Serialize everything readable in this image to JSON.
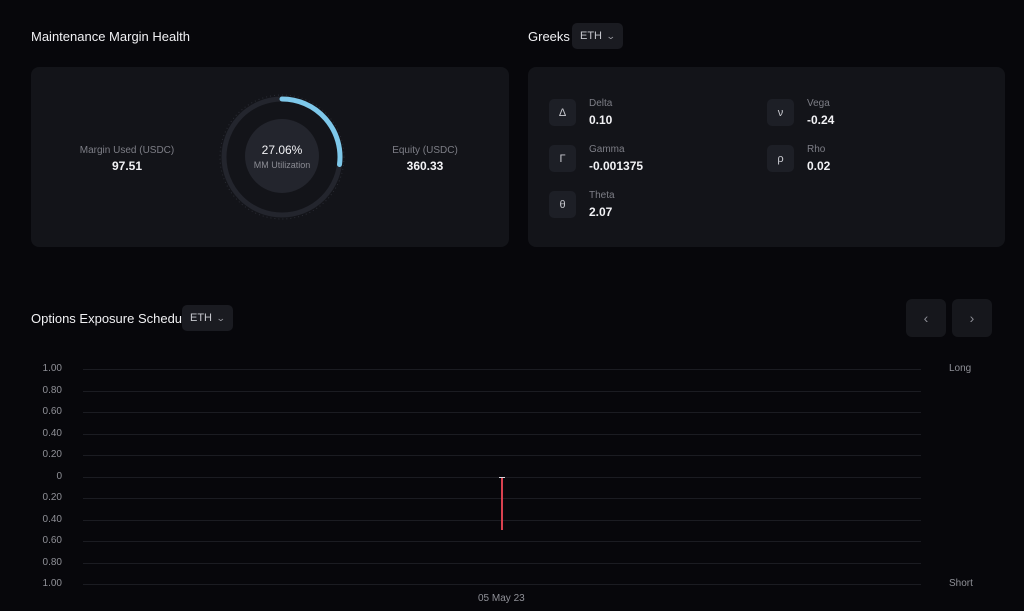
{
  "margin_health": {
    "title": "Maintenance Margin Health",
    "margin_used_label": "Margin Used (USDC)",
    "margin_used_value": "97.51",
    "equity_label": "Equity (USDC)",
    "equity_value": "360.33",
    "utilization_text": "27.06%",
    "utilization_label": "MM Utilization",
    "utilization_fraction": 0.2706,
    "arc_color": "#7ec8ea"
  },
  "greeks": {
    "title": "Greeks",
    "asset_selected": "ETH",
    "items": [
      {
        "icon": "delta-icon",
        "symbol": "Δ",
        "label": "Delta",
        "value": "0.10"
      },
      {
        "icon": "vega-icon",
        "symbol": "ν",
        "label": "Vega",
        "value": "-0.24"
      },
      {
        "icon": "gamma-icon",
        "symbol": "Γ",
        "label": "Gamma",
        "value": "-0.001375"
      },
      {
        "icon": "rho-icon",
        "symbol": "ρ",
        "label": "Rho",
        "value": "0.02"
      },
      {
        "icon": "theta-icon",
        "symbol": "θ",
        "label": "Theta",
        "value": "2.07"
      }
    ]
  },
  "exposure": {
    "title": "Options Exposure Schedule",
    "asset_selected": "ETH",
    "prev_icon": "chevron-left-icon",
    "next_icon": "chevron-right-icon",
    "prev_glyph": "‹",
    "next_glyph": "›",
    "long_label": "Long",
    "short_label": "Short",
    "date_label": "05 May 23"
  },
  "chart_data": {
    "type": "bar",
    "categories": [
      "05 May 23"
    ],
    "series": [
      {
        "values": [
          -0.5
        ]
      }
    ],
    "ylim": [
      -1,
      1
    ],
    "ytick_labels": [
      "1.00",
      "0.80",
      "0.60",
      "0.40",
      "0.20",
      "0",
      "0.20",
      "0.40",
      "0.60",
      "0.80",
      "1.00"
    ],
    "grid": true,
    "bar_color": "#d9414f"
  }
}
